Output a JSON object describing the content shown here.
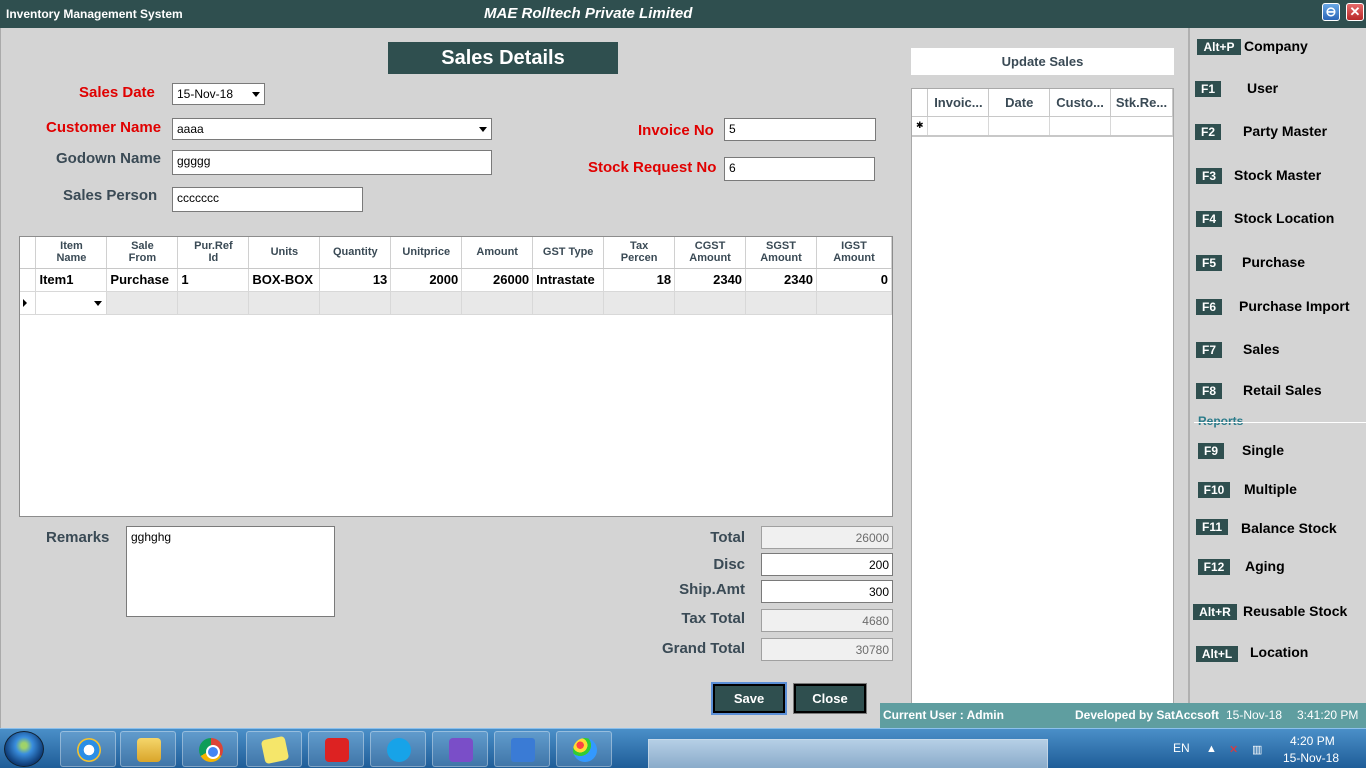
{
  "titlebar": {
    "app_title": "Inventory Management System",
    "company": "MAE Rolltech Private Limited",
    "minimize_glyph": "⊖",
    "close_glyph": "✕"
  },
  "form": {
    "heading": "Sales Details",
    "sales_date_label": "Sales Date",
    "sales_date_value": "15-Nov-18",
    "customer_name_label": "Customer Name",
    "customer_name_value": "aaaa",
    "godown_name_label": "Godown Name",
    "godown_name_value": "ggggg",
    "sales_person_label": "Sales Person",
    "sales_person_value": "ccccccc",
    "invoice_no_label": "Invoice No",
    "invoice_no_value": "5",
    "stock_request_no_label": "Stock Request No",
    "stock_request_no_value": "6"
  },
  "items_grid": {
    "columns": [
      [
        "Item",
        "Name"
      ],
      [
        "Sale",
        "From"
      ],
      [
        "Pur.Ref",
        "Id"
      ],
      [
        "Units",
        ""
      ],
      [
        "Quantity",
        ""
      ],
      [
        "Unitprice",
        ""
      ],
      [
        "Amount",
        ""
      ],
      [
        "GST Type",
        ""
      ],
      [
        "Tax",
        "Percen"
      ],
      [
        "CGST",
        "Amount"
      ],
      [
        "SGST",
        "Amount"
      ],
      [
        "IGST",
        "Amount"
      ]
    ],
    "rows": [
      [
        "Item1",
        "Purchase",
        "1",
        "BOX-BOX",
        "13",
        "2000",
        "26000",
        "Intrastate",
        "18",
        "2340",
        "2340",
        "0"
      ]
    ]
  },
  "remarks": {
    "label": "Remarks",
    "value": "gghghg"
  },
  "totals": {
    "total_label": "Total",
    "total_value": "26000",
    "disc_label": "Disc",
    "disc_value": "200",
    "ship_label": "Ship.Amt",
    "ship_value": "300",
    "tax_label": "Tax Total",
    "tax_value": "4680",
    "grand_label": "Grand Total",
    "grand_value": "30780"
  },
  "buttons": {
    "save": "Save",
    "close": "Close"
  },
  "update_sales": {
    "header": "Update Sales",
    "columns": [
      "Invoic...",
      "Date",
      "Custo...",
      "Stk.Re..."
    ],
    "new_row_marker": "✱"
  },
  "sidemenu": {
    "items": [
      {
        "key": "Alt+P",
        "label": "Company"
      },
      {
        "key": "F1",
        "label": "User"
      },
      {
        "key": "F2",
        "label": "Party Master"
      },
      {
        "key": "F3",
        "label": "Stock Master"
      },
      {
        "key": "F4",
        "label": "Stock Location"
      },
      {
        "key": "F5",
        "label": "Purchase"
      },
      {
        "key": "F6",
        "label": "Purchase Import"
      },
      {
        "key": "F7",
        "label": "Sales"
      },
      {
        "key": "F8",
        "label": "Retail Sales"
      }
    ],
    "reports_header": "Reports",
    "reports": [
      {
        "key": "F9",
        "label": "Single"
      },
      {
        "key": "F10",
        "label": "Multiple"
      },
      {
        "key": "F11",
        "label": "Balance Stock"
      },
      {
        "key": "F12",
        "label": "Aging"
      },
      {
        "key": "Alt+R",
        "label": "Reusable Stock"
      },
      {
        "key": "Alt+L",
        "label": "Location"
      }
    ]
  },
  "statusbar": {
    "current_user": "Current User : Admin",
    "developed_by": "Developed by SatAccsoft",
    "date": "15-Nov-18",
    "time": "3:41:20 PM"
  },
  "taskbar": {
    "lang": "EN",
    "clock_time": "4:20 PM",
    "clock_date": "15-Nov-18"
  }
}
